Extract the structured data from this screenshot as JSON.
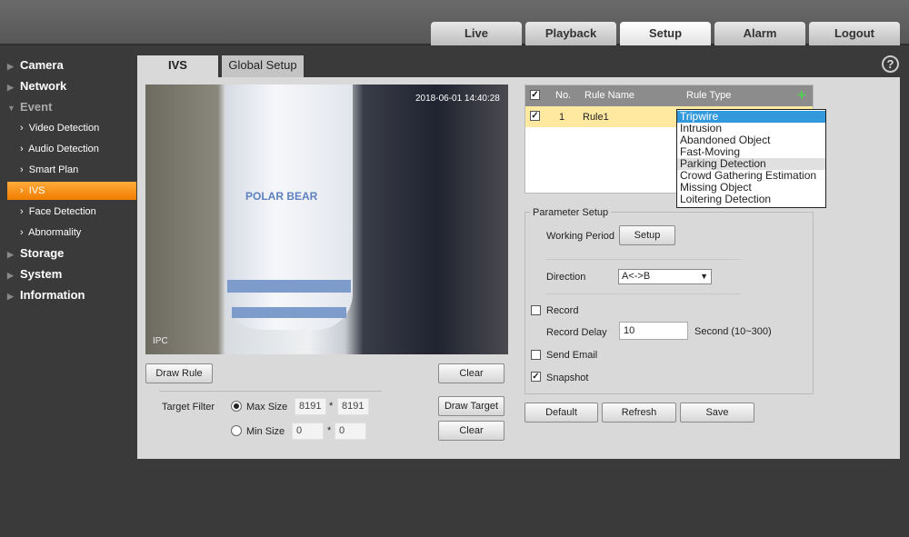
{
  "nav": {
    "tabs": [
      "Live",
      "Playback",
      "Setup",
      "Alarm",
      "Logout"
    ],
    "active": "Setup"
  },
  "sidebar": {
    "items": [
      {
        "label": "Camera"
      },
      {
        "label": "Network"
      },
      {
        "label": "Event"
      },
      {
        "label": "Video Detection"
      },
      {
        "label": "Audio Detection"
      },
      {
        "label": "Smart Plan"
      },
      {
        "label": "IVS"
      },
      {
        "label": "Face Detection"
      },
      {
        "label": "Abnormality"
      },
      {
        "label": "Storage"
      },
      {
        "label": "System"
      },
      {
        "label": "Information"
      }
    ]
  },
  "page_tabs": [
    "IVS",
    "Global Setup"
  ],
  "help_icon": "?",
  "video": {
    "timestamp": "2018-06-01 14:40:28",
    "channel": "IPC",
    "mug_text": "POLAR BEAR"
  },
  "left_buttons": {
    "draw_rule": "Draw Rule",
    "clear": "Clear",
    "draw_target": "Draw Target",
    "clear2": "Clear"
  },
  "target_filter": {
    "label": "Target Filter",
    "max_label": "Max Size",
    "max_w": "8191",
    "max_h": "8191",
    "min_label": "Min Size",
    "min_w": "0",
    "min_h": "0",
    "sep": "*",
    "selected": "Max Size"
  },
  "rules_table": {
    "headers": [
      "No.",
      "Rule Name",
      "Rule Type"
    ],
    "rows": [
      {
        "no": "1",
        "name": "Rule1",
        "checked": true
      }
    ]
  },
  "rule_type_dropdown": {
    "options": [
      "Tripwire",
      "Intrusion",
      "Abandoned Object",
      "Fast-Moving",
      "Parking Detection",
      "Crowd Gathering Estimation",
      "Missing Object",
      "Loitering Detection"
    ],
    "selected": "Tripwire",
    "hovered": "Parking Detection"
  },
  "params": {
    "legend": "Parameter Setup",
    "working_period": "Working Period",
    "setup_btn": "Setup",
    "direction_label": "Direction",
    "direction_value": "A<->B",
    "record": "Record",
    "record_delay": "Record Delay",
    "record_delay_value": "10",
    "record_delay_unit": "Second (10~300)",
    "send_email": "Send Email",
    "snapshot": "Snapshot",
    "record_checked": false,
    "send_email_checked": false,
    "snapshot_checked": true
  },
  "bottom_buttons": {
    "default": "Default",
    "refresh": "Refresh",
    "save": "Save"
  },
  "colors": {
    "accent": "#f07d00",
    "selected_row": "#ffe9a0",
    "dropdown_selected": "#3399dd"
  }
}
